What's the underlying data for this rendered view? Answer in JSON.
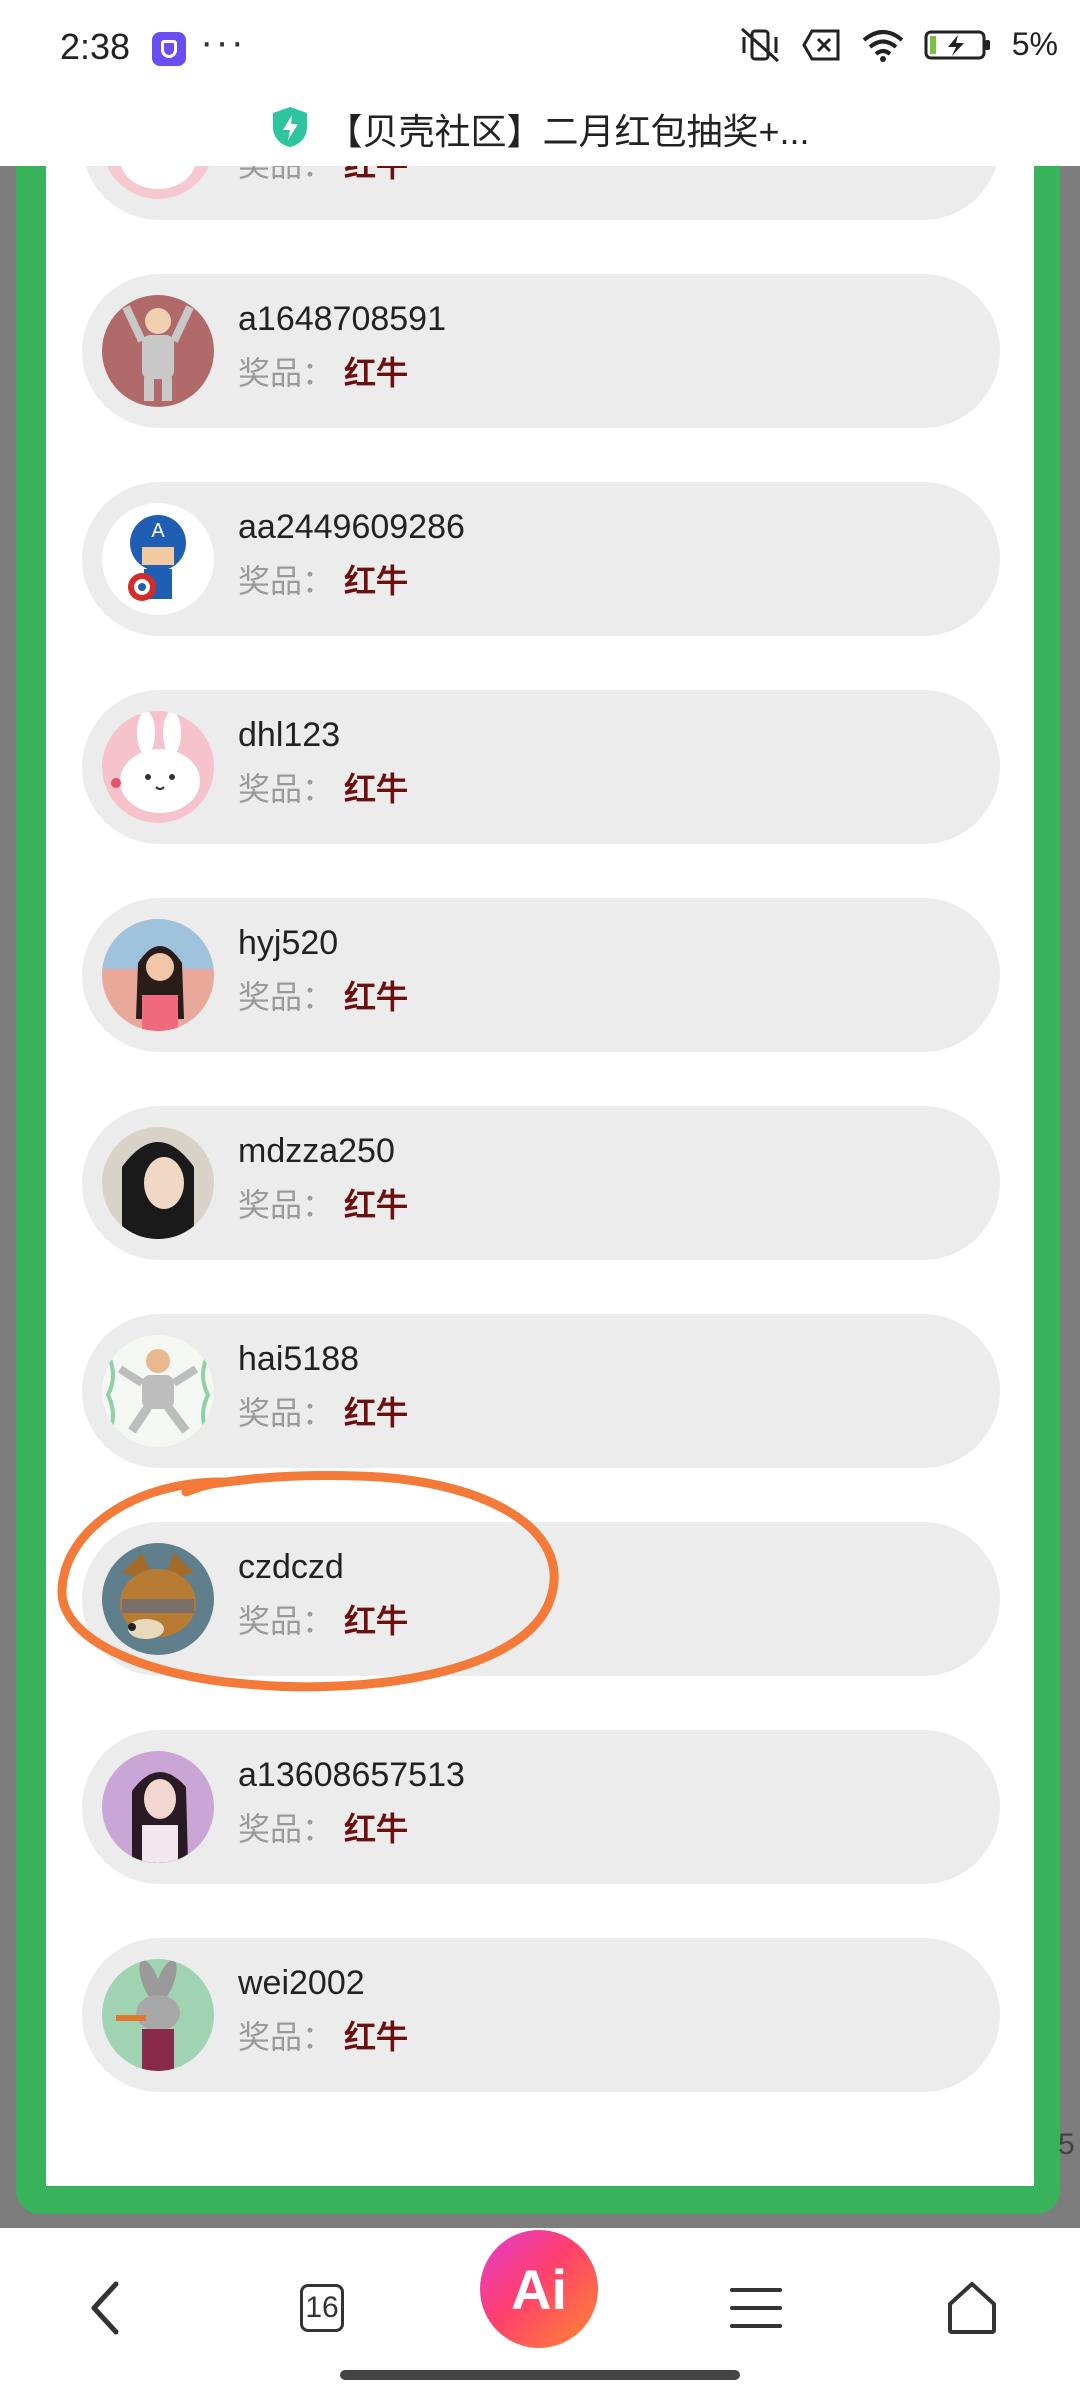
{
  "status_bar": {
    "time": "2:38",
    "more": "···",
    "battery": "5%"
  },
  "title_bar": {
    "title": "【贝壳社区】二月红包抽奖+..."
  },
  "winners": [
    {
      "username": "",
      "prize_label": "奖品：",
      "prize": "红牛",
      "avatar": "bunny"
    },
    {
      "username": "a1648708591",
      "prize_label": "奖品：",
      "prize": "红牛",
      "avatar": "hanging-figure"
    },
    {
      "username": "aa2449609286",
      "prize_label": "奖品：",
      "prize": "红牛",
      "avatar": "captain-hero"
    },
    {
      "username": "dhl123",
      "prize_label": "奖品：",
      "prize": "红牛",
      "avatar": "bunny"
    },
    {
      "username": "hyj520",
      "prize_label": "奖品：",
      "prize": "红牛",
      "avatar": "girl-photo"
    },
    {
      "username": "mdzza250",
      "prize_label": "奖品：",
      "prize": "红牛",
      "avatar": "portrait-photo"
    },
    {
      "username": "hai5188",
      "prize_label": "奖品：",
      "prize": "红牛",
      "avatar": "dancing-figure"
    },
    {
      "username": "czdczd",
      "prize_label": "奖品：",
      "prize": "红牛",
      "avatar": "dog-cartoon"
    },
    {
      "username": "a13608657513",
      "prize_label": "奖品：",
      "prize": "红牛",
      "avatar": "woman-photo"
    },
    {
      "username": "wei2002",
      "prize_label": "奖品：",
      "prize": "红牛",
      "avatar": "rabbit-cartoon"
    }
  ],
  "edge_digit": "5",
  "bottom_nav": {
    "tab_count": "16",
    "ai_label": "Ai"
  },
  "colors": {
    "frame_green": "#38b35b",
    "prize_red": "#6b0f0f",
    "highlight_orange": "#f47a3a"
  }
}
